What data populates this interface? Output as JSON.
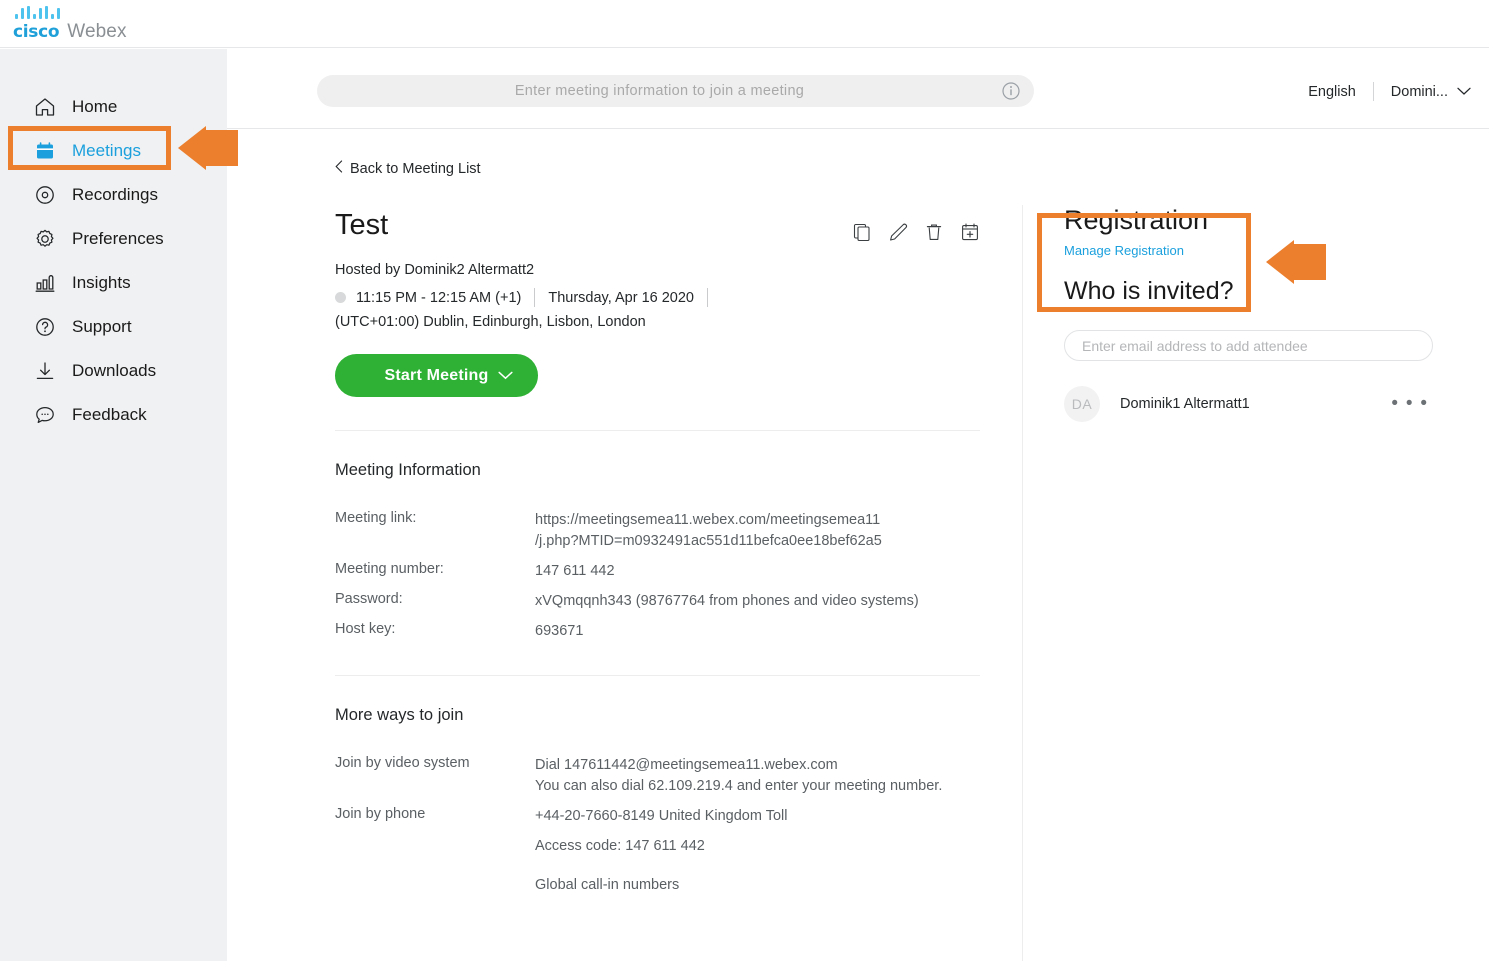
{
  "brand": {
    "cisco": "cisco",
    "product": "Webex",
    "logo_bar_heights": [
      5,
      11,
      13,
      5,
      11,
      13,
      5,
      11
    ]
  },
  "sidebar": {
    "items": [
      {
        "label": "Home",
        "icon": "home-icon",
        "active": false
      },
      {
        "label": "Meetings",
        "icon": "calendar-icon",
        "active": true
      },
      {
        "label": "Recordings",
        "icon": "record-icon",
        "active": false
      },
      {
        "label": "Preferences",
        "icon": "gear-icon",
        "active": false
      },
      {
        "label": "Insights",
        "icon": "bar-chart-icon",
        "active": false
      },
      {
        "label": "Support",
        "icon": "help-icon",
        "active": false
      },
      {
        "label": "Downloads",
        "icon": "download-icon",
        "active": false
      },
      {
        "label": "Feedback",
        "icon": "chat-icon",
        "active": false
      }
    ]
  },
  "topbar": {
    "join_placeholder": "Enter meeting information to join a meeting",
    "info_icon": "info-icon",
    "language": "English",
    "user": "Domini...",
    "user_chevron": "chevron-down-icon"
  },
  "main": {
    "back_link": "Back to Meeting List",
    "back_chevron": "chevron-left-icon",
    "meeting_title": "Test",
    "actions": [
      {
        "name": "copy-icon"
      },
      {
        "name": "edit-pencil-icon"
      },
      {
        "name": "delete-trash-icon"
      },
      {
        "name": "add-to-calendar-icon"
      }
    ],
    "hosted_by": "Hosted by Dominik2 Altermatt2",
    "time": "11:15 PM - 12:15 AM (+1)",
    "date": "Thursday, Apr 16 2020",
    "timezone": "(UTC+01:00) Dublin, Edinburgh, Lisbon, London",
    "start_button": "Start Meeting",
    "start_button_chevron": "chevron-down-icon",
    "meeting_information": {
      "heading": "Meeting Information",
      "rows": [
        {
          "key": "Meeting link:",
          "value_line1": "https://meetingsemea11.webex.com/meetingsemea11",
          "value_line2": "/j.php?MTID=m0932491ac551d11befca0ee18bef62a5"
        },
        {
          "key": "Meeting number:",
          "value_line1": "147 611 442"
        },
        {
          "key": "Password:",
          "value_line1": "xVQmqqnh343 (98767764 from phones and video systems)"
        },
        {
          "key": "Host key:",
          "value_line1": "693671"
        }
      ]
    },
    "more_ways": {
      "heading": "More ways to join",
      "rows": [
        {
          "key": "Join by video system",
          "value_line1": "Dial 147611442@meetingsemea11.webex.com",
          "value_line2": "You can also dial 62.109.219.4 and enter your meeting number."
        },
        {
          "key": "Join by phone",
          "value_line1": "+44-20-7660-8149 United Kingdom Toll"
        },
        {
          "key": "",
          "value_line1": "Access code: 147 611 442"
        }
      ],
      "global_link": "Global call-in numbers"
    }
  },
  "right_panel": {
    "registration_heading": "Registration",
    "manage_registration": "Manage Registration",
    "invited_heading": "Who is invited?",
    "email_placeholder": "Enter email address to add attendee",
    "attendees": [
      {
        "initials": "DA",
        "name": "Dominik1 Altermatt1",
        "menu": "more-options-icon"
      }
    ]
  },
  "annotations": {
    "highlight_color": "#ec7f2e",
    "arrows": [
      {
        "target": "sidebar-item-meetings"
      },
      {
        "target": "registration-heading"
      }
    ]
  },
  "colors": {
    "accent_blue": "#1ba0dd",
    "start_green": "#2eb135",
    "sidebar_bg": "#f0f1f2",
    "highlight_orange": "#ec7f2e"
  }
}
